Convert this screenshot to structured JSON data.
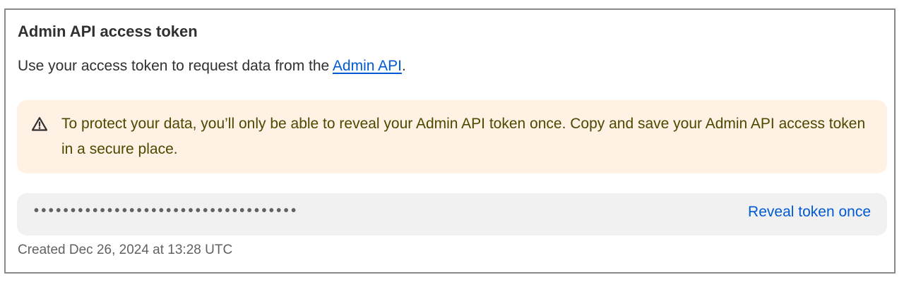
{
  "card": {
    "title": "Admin API access token",
    "description_prefix": "Use your access token to request data from the ",
    "description_link": "Admin API",
    "description_suffix": "."
  },
  "banner": {
    "icon": "warning-triangle-icon",
    "text": "To protect your data, you’ll only be able to reveal your Admin API token once. Copy and save your Admin API access token in a secure place.",
    "background": "#fff1e3",
    "text_color": "#4f4700"
  },
  "token": {
    "masked_value": "••••••••••••••••••••••••••••••••••••",
    "reveal_label": "Reveal token once"
  },
  "meta": {
    "created": "Created Dec 26, 2024 at 13:28 UTC"
  },
  "colors": {
    "link": "#005bd3",
    "field_background": "#f1f1f1"
  }
}
